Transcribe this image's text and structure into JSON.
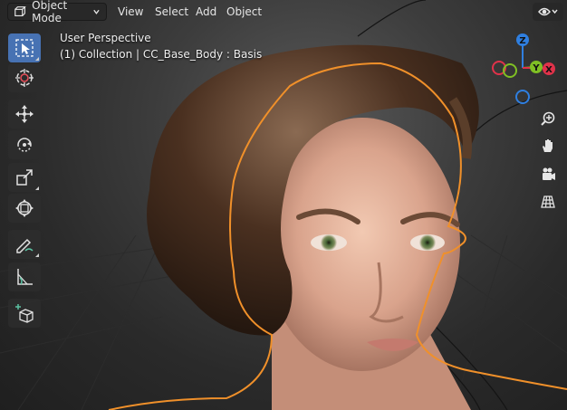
{
  "header": {
    "mode_label": "Object Mode",
    "menu": [
      "View",
      "Select",
      "Add",
      "Object"
    ]
  },
  "viewport": {
    "view_name": "User Perspective",
    "collection_info": "(1) Collection | CC_Base_Body : Basis"
  },
  "toolbar": {
    "tools": [
      {
        "name": "select-box",
        "icon": "select-box-icon",
        "active": true
      },
      {
        "name": "cursor",
        "icon": "cursor-icon",
        "active": false
      },
      {
        "name": "move",
        "icon": "move-icon",
        "active": false
      },
      {
        "name": "rotate",
        "icon": "rotate-icon",
        "active": false
      },
      {
        "name": "scale",
        "icon": "scale-icon",
        "active": false
      },
      {
        "name": "transform",
        "icon": "transform-icon",
        "active": false
      },
      {
        "name": "annotate",
        "icon": "annotate-icon",
        "active": false
      },
      {
        "name": "measure",
        "icon": "measure-icon",
        "active": false
      },
      {
        "name": "add-cube",
        "icon": "add-cube-icon",
        "active": false
      }
    ]
  },
  "gizmo": {
    "axes": [
      {
        "label": "Z",
        "color": "#2f7fe0"
      },
      {
        "label": "Y",
        "color": "#7fbf24"
      },
      {
        "label": "X",
        "color": "#e0324a"
      }
    ]
  },
  "navigation": [
    "zoom-icon",
    "hand-icon",
    "camera-icon",
    "grid-icon"
  ],
  "colors": {
    "accent": "#4772b3",
    "selection_outline": "#f0902a"
  }
}
